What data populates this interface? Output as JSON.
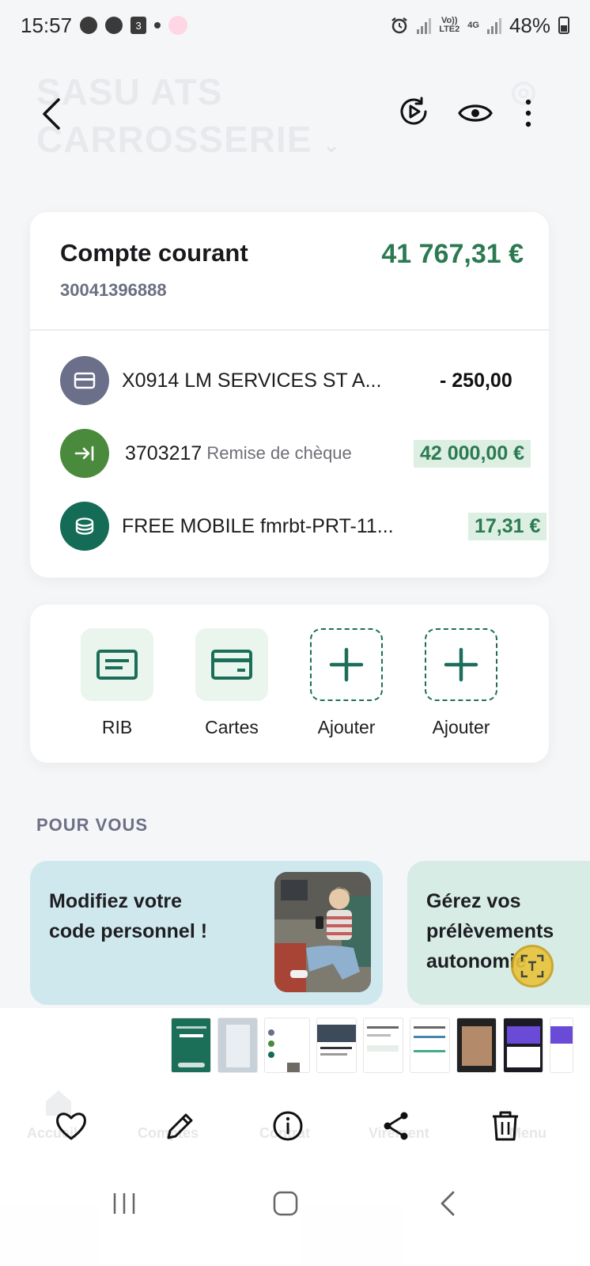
{
  "status_bar": {
    "time": "15:57",
    "calendar_badge": "3",
    "network_volte": "Vo))",
    "network_lte": "LTE2",
    "network_4g": "4G",
    "battery": "48%"
  },
  "header": {
    "company_name_line1": "SASU ATS",
    "company_name_line2": "CARROSSERIE"
  },
  "account": {
    "name": "Compte courant",
    "number": "30041396888",
    "balance": "41 767,31 €",
    "transactions": [
      {
        "label": "X0914 LM SERVICES ST A...",
        "sub": "",
        "amount": "- 250,00",
        "icon": "card-icon",
        "color": "#6b6f8a"
      },
      {
        "label": "3703217",
        "sub": "Remise de chèque",
        "amount": "42 000,00 €",
        "icon": "arrow-in-icon",
        "color": "#4a8a3c"
      },
      {
        "label": "FREE MOBILE fmrbt-PRT-11...",
        "sub": "",
        "amount": "17,31 €",
        "icon": "coins-icon",
        "color": "#146c57"
      }
    ]
  },
  "quick_actions": [
    {
      "label": "RIB",
      "icon": "rib-icon"
    },
    {
      "label": "Cartes",
      "icon": "card-icon"
    },
    {
      "label": "Ajouter",
      "icon": "plus-icon"
    },
    {
      "label": "Ajouter",
      "icon": "plus-icon"
    }
  ],
  "pour_vous": {
    "title": "POUR VOUS",
    "cards": [
      {
        "text_line1": "Modifiez votre",
        "text_line2": "code personnel !"
      },
      {
        "text_line1": "Gérez vos",
        "text_line2": "prélèvements",
        "text_line3": "autonomie"
      }
    ]
  },
  "ghost_nav": [
    "Accueil",
    "Comptes",
    "Contrat",
    "Virement",
    "Menu"
  ],
  "gallery_actions": [
    {
      "name": "favorite",
      "icon": "heart-icon"
    },
    {
      "name": "edit",
      "icon": "pencil-icon"
    },
    {
      "name": "info",
      "icon": "info-icon"
    },
    {
      "name": "share",
      "icon": "share-icon"
    },
    {
      "name": "delete",
      "icon": "trash-icon"
    }
  ],
  "colors": {
    "accent_green": "#2b7a52",
    "dark_teal": "#1c6e5a",
    "positive_bg": "#dcefe2"
  }
}
